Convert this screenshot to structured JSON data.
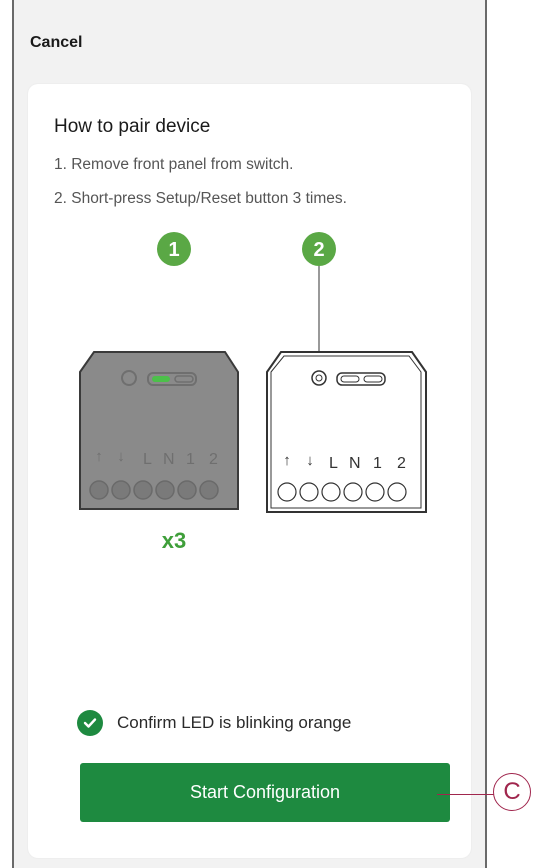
{
  "header": {
    "cancel_label": "Cancel"
  },
  "instructions": {
    "title": "How to pair device",
    "steps": [
      "1. Remove front panel from switch.",
      "2. Short-press Setup/Reset button 3 times."
    ]
  },
  "illustration": {
    "markers": [
      "1",
      "2"
    ],
    "press_count_label": "x3",
    "terminal_labels": [
      "1",
      "2",
      "L",
      "N",
      "1",
      "2"
    ]
  },
  "confirm": {
    "text": "Confirm LED is blinking orange"
  },
  "actions": {
    "start_label": "Start Configuration"
  },
  "callout": {
    "label": "C"
  },
  "colors": {
    "accent_green": "#1e8a40",
    "marker_green": "#5aa845",
    "callout": "#a0264d",
    "device_dark": "#8a8a8a"
  }
}
